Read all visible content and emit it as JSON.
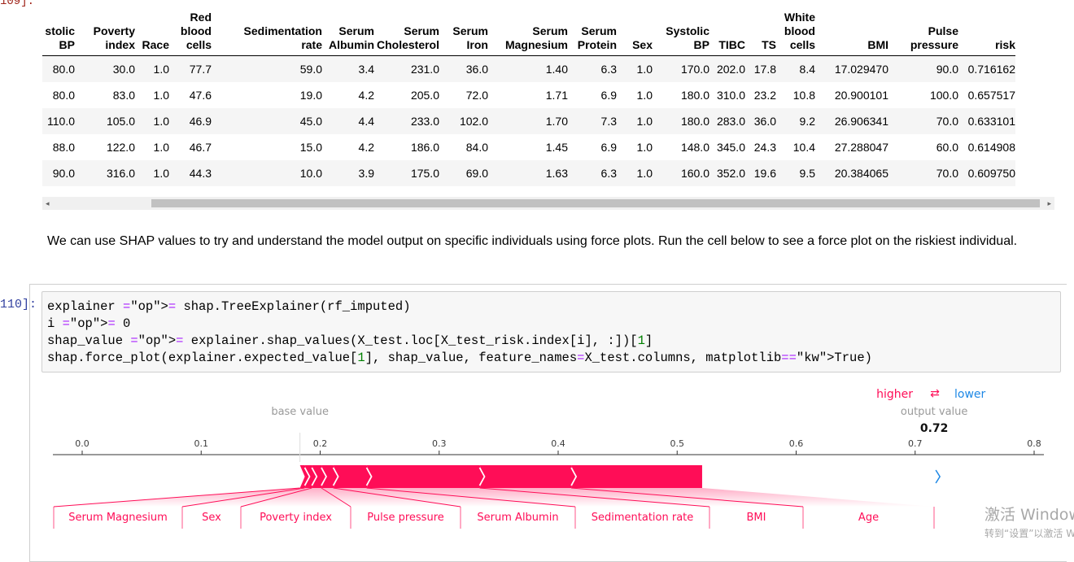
{
  "prev_prompt": "109]:",
  "table": {
    "columns": [
      "stolic\nBP",
      "Poverty\nindex",
      "Race",
      "Red\nblood\ncells",
      "Sedimentation\nrate",
      "Serum\nAlbumin",
      "Serum\nCholesterol",
      "Serum\nIron",
      "Serum\nMagnesium",
      "Serum\nProtein",
      "Sex",
      "Systolic\nBP",
      "TIBC",
      "TS",
      "White\nblood\ncells",
      "BMI",
      "Pulse\npressure",
      "risk"
    ],
    "rows": [
      [
        "80.0",
        "30.0",
        "1.0",
        "77.7",
        "59.0",
        "3.4",
        "231.0",
        "36.0",
        "1.40",
        "6.3",
        "1.0",
        "170.0",
        "202.0",
        "17.8",
        "8.4",
        "17.029470",
        "90.0",
        "0.716162"
      ],
      [
        "80.0",
        "83.0",
        "1.0",
        "47.6",
        "19.0",
        "4.2",
        "205.0",
        "72.0",
        "1.71",
        "6.9",
        "1.0",
        "180.0",
        "310.0",
        "23.2",
        "10.8",
        "20.900101",
        "100.0",
        "0.657517"
      ],
      [
        "110.0",
        "105.0",
        "1.0",
        "46.9",
        "45.0",
        "4.4",
        "233.0",
        "102.0",
        "1.70",
        "7.3",
        "1.0",
        "180.0",
        "283.0",
        "36.0",
        "9.2",
        "26.906341",
        "70.0",
        "0.633101"
      ],
      [
        "88.0",
        "122.0",
        "1.0",
        "46.7",
        "15.0",
        "4.2",
        "186.0",
        "84.0",
        "1.45",
        "6.9",
        "1.0",
        "148.0",
        "345.0",
        "24.3",
        "10.4",
        "27.288047",
        "60.0",
        "0.614908"
      ],
      [
        "90.0",
        "316.0",
        "1.0",
        "44.3",
        "10.0",
        "3.9",
        "175.0",
        "69.0",
        "1.63",
        "6.3",
        "1.0",
        "160.0",
        "352.0",
        "19.6",
        "9.5",
        "20.384065",
        "70.0",
        "0.609750"
      ]
    ]
  },
  "scrollbar": {
    "left_arrow": "◂",
    "right_arrow": "▸"
  },
  "markdown": "We can use SHAP values to try and understand the model output on specific individuals using force plots. Run the cell below to see a force plot on the riskiest individual.",
  "code_cell": {
    "prompt": "110]:",
    "lines": [
      "explainer = shap.TreeExplainer(rf_imputed)",
      "i = 0",
      "shap_value = explainer.shap_values(X_test.loc[X_test_risk.index[i], :])[1]",
      "shap.force_plot(explainer.expected_value[1], shap_value, feature_names=X_test.columns, matplotlib=True)"
    ]
  },
  "force_plot": {
    "legend": {
      "higher": "higher",
      "arrows": "⇄",
      "lower": "lower"
    },
    "base_value_label": "base value",
    "output_value_label": "output value",
    "output_value": "0.72",
    "base_value": 0.183,
    "output": 0.716,
    "axis": {
      "min": 0.0,
      "max": 0.8,
      "ticks": [
        "0.0",
        "0.1",
        "0.2",
        "0.3",
        "0.4",
        "0.5",
        "0.6",
        "0.7",
        "0.8"
      ]
    },
    "features": [
      {
        "name": "Serum Magnesium",
        "value": 0.004
      },
      {
        "name": "Sex",
        "value": 0.006
      },
      {
        "name": "Poverty index",
        "value": 0.008
      },
      {
        "name": "Pulse pressure",
        "value": 0.01
      },
      {
        "name": "Serum Albumin",
        "value": 0.028
      },
      {
        "name": "Sedimentation rate",
        "value": 0.095
      },
      {
        "name": "BMI",
        "value": 0.077
      },
      {
        "name": "Age",
        "value": 0.11
      }
    ],
    "colors": {
      "positive": "#ff0d57",
      "negative": "#1e88e5",
      "axis_text": "#3c3c3c"
    }
  },
  "watermark": {
    "line1": "激活 Windows",
    "line2": "转到“设置”以激活 Windows"
  }
}
